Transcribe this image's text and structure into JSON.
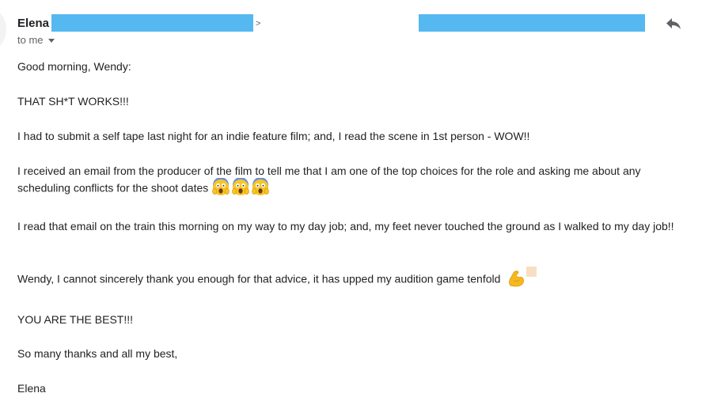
{
  "header": {
    "sender_name": "Elena",
    "email_suffix": ">",
    "recipient_label": "to me"
  },
  "message": {
    "greeting": "Good morning, Wendy:",
    "line1": "THAT SH*T WORKS!!!",
    "line2": "I had to submit a self tape last night for an indie feature film; and, I read the scene in 1st person - WOW!!",
    "line3": "I received an email from the producer of the film to tell me that I am one of the top choices for the role and asking me about any scheduling conflicts for the shoot dates",
    "line4": "I read that email on the train this morning on my way to my day job; and, my feet never touched the ground as I walked to my day job!!",
    "line5": "Wendy, I cannot sincerely thank you enough for that advice, it has upped my audition game tenfold",
    "line6": "YOU ARE THE BEST!!!",
    "closing": "So many thanks and all my best,",
    "signature": "Elena"
  },
  "icons": {
    "reply": "reply-arrow-icon",
    "recipient_dropdown": "chevron-down-icon",
    "emoji_scream": "face-screaming-in-fear-emoji",
    "emoji_flex": "flexed-biceps-emoji"
  },
  "colors": {
    "redaction": "#55b8f0",
    "text": "#222222",
    "muted": "#5f6368"
  }
}
